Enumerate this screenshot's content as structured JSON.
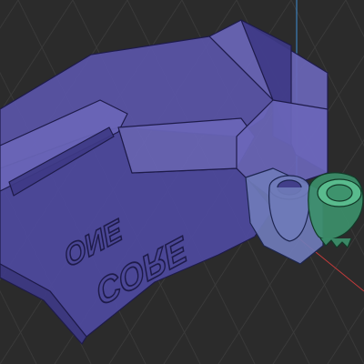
{
  "viewport": {
    "background": "#2b2b2b",
    "grid_color": "#3a3a3a",
    "axis_y_color": "#3f8fd6",
    "axis_x_color": "#c33b3b"
  },
  "model": {
    "tray": {
      "fill_top": "#5a55a8",
      "fill_floor": "#4e4aa0",
      "fill_wall": "#6a66b8",
      "fill_dark": "#3e3a86",
      "edge_color": "#1e1b4a",
      "emboss": [
        "ONE",
        "CORE"
      ]
    },
    "selected_part": {
      "fill": "#3c8f6a",
      "highlight": "#5cbf90",
      "edge_color": "#123a28"
    },
    "holder": {
      "fill": "#6f7bb8",
      "edge_color": "#1d2550"
    }
  }
}
